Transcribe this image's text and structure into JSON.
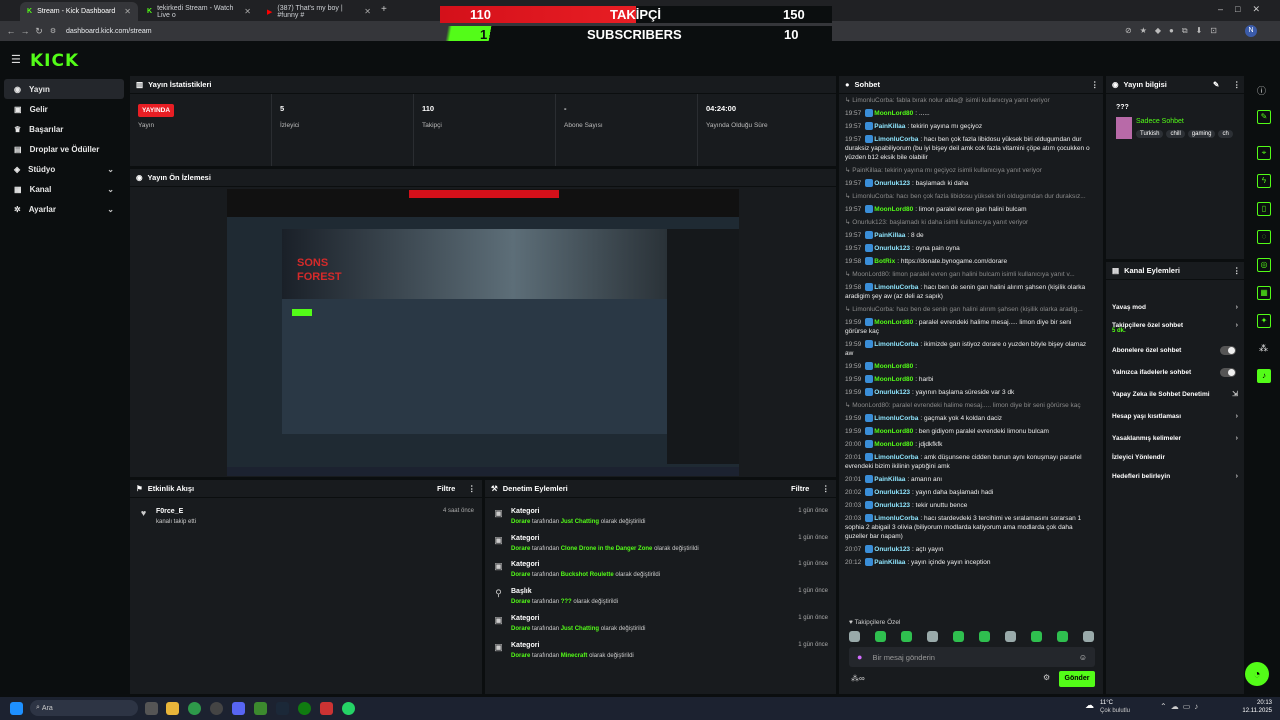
{
  "browser": {
    "tabs": [
      {
        "title": "Stream - Kick Dashboard",
        "active": true
      },
      {
        "title": "tekirkedi Stream - Watch Live o",
        "active": false
      },
      {
        "title": "(387) That's my boy | #funny #",
        "active": false
      }
    ],
    "url": "dashboard.kick.com/stream"
  },
  "banner": {
    "row1": {
      "left": "110",
      "label": "TAKİPÇİ",
      "right": "150"
    },
    "row2": {
      "left": "1",
      "label": "SUBSCRIBERS",
      "right": "10"
    }
  },
  "sidebar": {
    "items": [
      {
        "label": "Yayın",
        "icon": "broadcast-icon"
      },
      {
        "label": "Gelir",
        "icon": "wallet-icon"
      },
      {
        "label": "Başarılar",
        "icon": "trophy-icon"
      },
      {
        "label": "Droplar ve Ödüller",
        "icon": "gift-icon"
      },
      {
        "label": "Stüdyo",
        "icon": "palette-icon"
      },
      {
        "label": "Kanal",
        "icon": "person-icon"
      },
      {
        "label": "Ayarlar",
        "icon": "gear-icon"
      }
    ]
  },
  "stats": {
    "title": "Yayın İstatistikleri",
    "live_badge": "YAYINDA",
    "live_label": "Yayın",
    "items": [
      {
        "value": "5",
        "label": "İzleyici"
      },
      {
        "value": "110",
        "label": "Takipçi"
      },
      {
        "value": "-",
        "label": "Abone Sayısı"
      },
      {
        "value": "04:24:00",
        "label": "Yayında Olduğu Süre"
      }
    ]
  },
  "preview": {
    "title": "Yayın Ön İzlemesi",
    "game_title_line1": "SONS",
    "game_title_line2": "FOREST"
  },
  "activity": {
    "title": "Etkinlik Akışı",
    "filter": "Filtre",
    "items": [
      {
        "user": "F0rce_E",
        "desc": "kanalı takip etti",
        "ago": "4 saat önce"
      }
    ]
  },
  "moderation": {
    "title": "Denetim Eylemleri",
    "filter": "Filtre",
    "by": "Dorare",
    "suffix_mid": "tarafından",
    "suffix_end": "olarak değiştirildi",
    "items": [
      {
        "title": "Kategori",
        "value": "Just Chatting",
        "ago": "1 gün önce",
        "icon": "category-icon"
      },
      {
        "title": "Kategori",
        "value": "Clone Drone in the Danger Zone",
        "ago": "1 gün önce",
        "icon": "category-icon"
      },
      {
        "title": "Kategori",
        "value": "Buckshot Roulette",
        "ago": "1 gün önce",
        "icon": "category-icon"
      },
      {
        "title": "Başlık",
        "value": "???",
        "ago": "1 gün önce",
        "icon": "title-icon"
      },
      {
        "title": "Kategori",
        "value": "Just Chatting",
        "ago": "1 gün önce",
        "icon": "category-icon"
      },
      {
        "title": "Kategori",
        "value": "Minecraft",
        "ago": "1 gün önce",
        "icon": "category-icon"
      }
    ]
  },
  "chat": {
    "title": "Sohbet",
    "messages": [
      {
        "reply": true,
        "text": "LimonluCorba: fabla bırak nolur abla@ isimli kullanıcıya yanıt veriyor"
      },
      {
        "time": "19:57",
        "user": "MoonLord80",
        "color": "#53fc18",
        "text": "......"
      },
      {
        "time": "19:57",
        "user": "PainKillaa",
        "color": "#8fe6ff",
        "text": "tekirin yayına mı geçiyoz"
      },
      {
        "time": "19:57",
        "user": "LimonluCorba",
        "color": "#8fe6ff",
        "text": "hacı ben çok fazla libidosu yüksek biri oldugumdan dur duraksiz yapabiliyorum (bu iyi bişey deil amk cok fazla vitamini çöpe atım çocukken o yüzden b12 eksik bile olabilir"
      },
      {
        "reply": true,
        "text": "PainKillaa: tekirin yayına mı geçiyoz isimli kullanıcıya yanıt veriyor"
      },
      {
        "time": "19:57",
        "user": "Onurluk123",
        "color": "#8fe6ff",
        "text": "başlamadı ki daha"
      },
      {
        "reply": true,
        "text": "LimonluCorba: hacı ben çok fazla libidosu yüksek biri oldugumdan dur duraksız..."
      },
      {
        "time": "19:57",
        "user": "MoonLord80",
        "color": "#53fc18",
        "text": "limon paralel evren garı halini bulcam"
      },
      {
        "reply": true,
        "text": "Onurluk123: başlamadı ki daha isimli kullanıcıya yanıt veriyor"
      },
      {
        "time": "19:57",
        "user": "PainKillaa",
        "color": "#8fe6ff",
        "text": "8 de"
      },
      {
        "time": "19:57",
        "user": "Onurluk123",
        "color": "#8fe6ff",
        "text": "oyna pain oyna"
      },
      {
        "time": "19:58",
        "user": "BotRix",
        "color": "#53fc18",
        "text": "https://donate.bynogame.com/dorare"
      },
      {
        "reply": true,
        "text": "MoonLord80: limon paralel evren garı halini bulcam isimli kullanıcıya yanıt v..."
      },
      {
        "time": "19:58",
        "user": "LimonluCorba",
        "color": "#8fe6ff",
        "text": "hacı ben de senin garı halini alırım şahsen (kişilik olarka aradigim şey aw (az deli az sapık)"
      },
      {
        "reply": true,
        "text": "LimonluCorba: hacı ben de senin garı halini alırım şahsen (kişilik olarka aradig..."
      },
      {
        "time": "19:59",
        "user": "MoonLord80",
        "color": "#53fc18",
        "text": "paralel evrendeki halime mesaj..... limon diye bir seni görürse kaç"
      },
      {
        "time": "19:59",
        "user": "LimonluCorba",
        "color": "#8fe6ff",
        "text": "ikimizde garı istiyoz dorare o yuzden böyle bişey olamaz aw"
      },
      {
        "time": "19:59",
        "user": "MoonLord80",
        "color": "#53fc18",
        "text": ""
      },
      {
        "time": "19:59",
        "user": "MoonLord80",
        "color": "#53fc18",
        "text": "harbi"
      },
      {
        "time": "19:59",
        "user": "Onurluk123",
        "color": "#8fe6ff",
        "text": "yayının başlama süreside var 3 dk"
      },
      {
        "reply": true,
        "text": "MoonLord80: paralel evrendeki halime mesaj..... limon diye bir seni görürse kaç"
      },
      {
        "time": "19:59",
        "user": "LimonluCorba",
        "color": "#8fe6ff",
        "text": "gaçmak yok 4 koldan daciz"
      },
      {
        "time": "19:59",
        "user": "MoonLord80",
        "color": "#53fc18",
        "text": "ben gidiyom paralel evrendeki limonu bulcam"
      },
      {
        "time": "20:00",
        "user": "MoonLord80",
        "color": "#53fc18",
        "text": "jdjdkfkfk"
      },
      {
        "time": "20:01",
        "user": "LimonluCorba",
        "color": "#8fe6ff",
        "text": "amk düşunsene cidden bunun aynı konuşmayı pararlel evrendeki bizim ikilinin yaptığini amk"
      },
      {
        "time": "20:01",
        "user": "PainKillaa",
        "color": "#8fe6ff",
        "text": "amarın anı"
      },
      {
        "time": "20:02",
        "user": "Onurluk123",
        "color": "#8fe6ff",
        "text": "yayın daha başlamadı hadi"
      },
      {
        "time": "20:03",
        "user": "Onurluk123",
        "color": "#8fe6ff",
        "text": "tekir unuttu bence"
      },
      {
        "time": "20:03",
        "user": "LimonluCorba",
        "color": "#8fe6ff",
        "text": "hacı stardevdeki 3 tercihimi ve sıralamasını sorarsan 1 sophia 2 abigail 3 olivia (biliyorum modlarda katiyorum ama modlarda çok daha guzeller bar napam)"
      },
      {
        "time": "20:07",
        "user": "Onurluk123",
        "color": "#8fe6ff",
        "text": "açtı yayın"
      },
      {
        "time": "20:12",
        "user": "PainKillaa",
        "color": "#8fe6ff",
        "text": "yayın içinde yayın inception"
      }
    ],
    "followers_only": "Takipçilere Özel",
    "placeholder": "Bir mesaj gönderin",
    "send": "Gönder"
  },
  "stream_info": {
    "title": "Yayın bilgisi",
    "stream_title": "???",
    "category": "Sadece Sohbet",
    "tags": [
      "Turkish",
      "chill",
      "gaming",
      "ch"
    ]
  },
  "channel_actions": {
    "title": "Kanal Eylemleri",
    "items": [
      {
        "label": "Yavaş mod",
        "kind": "arrow"
      },
      {
        "label": "Takipçilere özel sohbet",
        "sub": "5 dk.",
        "kind": "arrow"
      },
      {
        "label": "Abonelere özel sohbet",
        "kind": "toggle"
      },
      {
        "label": "Yalnızca ifadelerle sohbet",
        "kind": "toggle"
      },
      {
        "label": "Yapay Zeka ile Sohbet Denetimi",
        "kind": "external"
      },
      {
        "label": "Hesap yaşı kısıtlaması",
        "kind": "arrow"
      },
      {
        "label": "Yasaklanmış kelimeler",
        "kind": "arrow"
      },
      {
        "label": "İzleyici Yönlendir",
        "kind": "none"
      },
      {
        "label": "Hedefleri belirleyin",
        "kind": "arrow"
      }
    ]
  },
  "taskbar": {
    "search": "Ara",
    "weather_temp": "11°C",
    "weather_desc": "Çok bulutlu",
    "time": "20:13",
    "date": "12.11.2025"
  },
  "colors": {
    "brand": "#53fc18",
    "live": "#e81e24",
    "panel": "#181b1e",
    "bg": "#0b0e0f"
  }
}
